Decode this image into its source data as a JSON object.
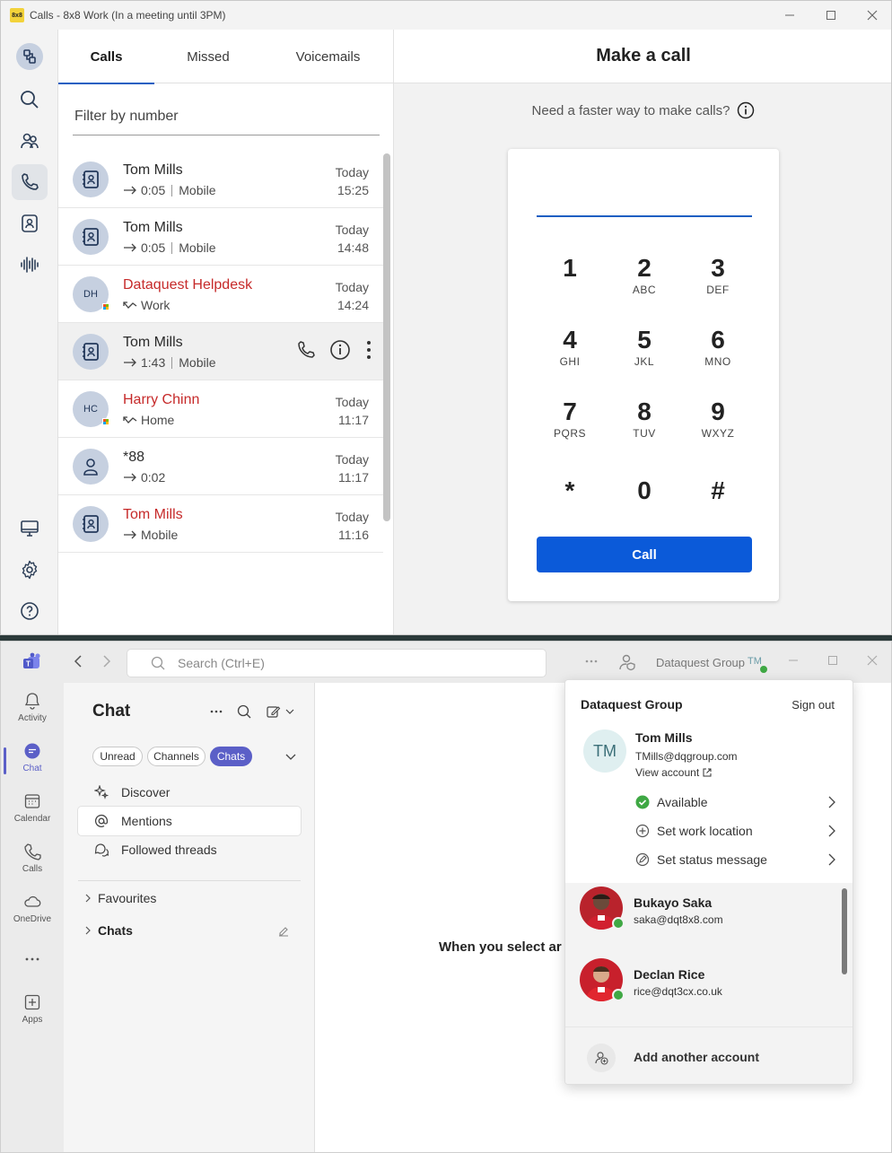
{
  "app88": {
    "window_title": "Calls - 8x8 Work (In a meeting until 3PM)",
    "logo_text": "8x8",
    "tabs": [
      {
        "label": "Calls"
      },
      {
        "label": "Missed"
      },
      {
        "label": "Voicemails"
      }
    ],
    "filter_placeholder": "Filter by number",
    "calls": [
      {
        "name": "Tom Mills",
        "duration": "0:05",
        "type": "Mobile",
        "date": "Today",
        "time": "15:25",
        "missed": false
      },
      {
        "name": "Tom Mills",
        "duration": "0:05",
        "type": "Mobile",
        "date": "Today",
        "time": "14:48",
        "missed": false
      },
      {
        "name": "Dataquest Helpdesk",
        "initials": "DH",
        "type": "Work",
        "date": "Today",
        "time": "14:24",
        "missed": true
      },
      {
        "name": "Tom Mills",
        "duration": "1:43",
        "type": "Mobile",
        "date": "",
        "time": "",
        "missed": false
      },
      {
        "name": "Harry Chinn",
        "initials": "HC",
        "type": "Home",
        "date": "Today",
        "time": "11:17",
        "missed": true
      },
      {
        "name": "*88",
        "duration": "0:02",
        "date": "Today",
        "time": "11:17",
        "missed": false
      },
      {
        "name": "Tom Mills",
        "type": "Mobile",
        "date": "Today",
        "time": "11:16",
        "missed": true
      }
    ],
    "make_call_title": "Make a call",
    "faster_text": "Need a faster way to make calls?",
    "keypad": [
      {
        "digit": "1",
        "letters": ""
      },
      {
        "digit": "2",
        "letters": "ABC"
      },
      {
        "digit": "3",
        "letters": "DEF"
      },
      {
        "digit": "4",
        "letters": "GHI"
      },
      {
        "digit": "5",
        "letters": "JKL"
      },
      {
        "digit": "6",
        "letters": "MNO"
      },
      {
        "digit": "7",
        "letters": "PQRS"
      },
      {
        "digit": "8",
        "letters": "TUV"
      },
      {
        "digit": "9",
        "letters": "WXYZ"
      },
      {
        "digit": "*",
        "letters": ""
      },
      {
        "digit": "0",
        "letters": ""
      },
      {
        "digit": "#",
        "letters": ""
      }
    ],
    "call_button": "Call",
    "accent": "#0b5ad9"
  },
  "teams": {
    "search_placeholder": "Search (Ctrl+E)",
    "org_name": "Dataquest Group",
    "user_initials": "TM",
    "rail": [
      {
        "label": "Activity"
      },
      {
        "label": "Chat"
      },
      {
        "label": "Calendar"
      },
      {
        "label": "Calls"
      },
      {
        "label": "OneDrive"
      },
      {
        "label": "Apps"
      }
    ],
    "chat_title": "Chat",
    "filters": [
      {
        "label": "Unread"
      },
      {
        "label": "Channels"
      },
      {
        "label": "Chats"
      }
    ],
    "nav": [
      {
        "label": "Discover"
      },
      {
        "label": "Mentions"
      },
      {
        "label": "Followed threads"
      }
    ],
    "sections": [
      {
        "label": "Favourites"
      },
      {
        "label": "Chats"
      }
    ],
    "main_text": "When you select ar",
    "accent": "#5b5fc7",
    "account_menu": {
      "org": "Dataquest Group",
      "sign_out": "Sign out",
      "initials": "TM",
      "name": "Tom Mills",
      "email": "TMills@dqgroup.com",
      "view_account": "View account",
      "status_rows": [
        {
          "label": "Available"
        },
        {
          "label": "Set work location"
        },
        {
          "label": "Set status message"
        }
      ],
      "other_accounts": [
        {
          "name": "Bukayo Saka",
          "email": "saka@dqt8x8.com"
        },
        {
          "name": "Declan Rice",
          "email": "rice@dqt3cx.co.uk"
        }
      ],
      "add_account": "Add another account"
    }
  }
}
